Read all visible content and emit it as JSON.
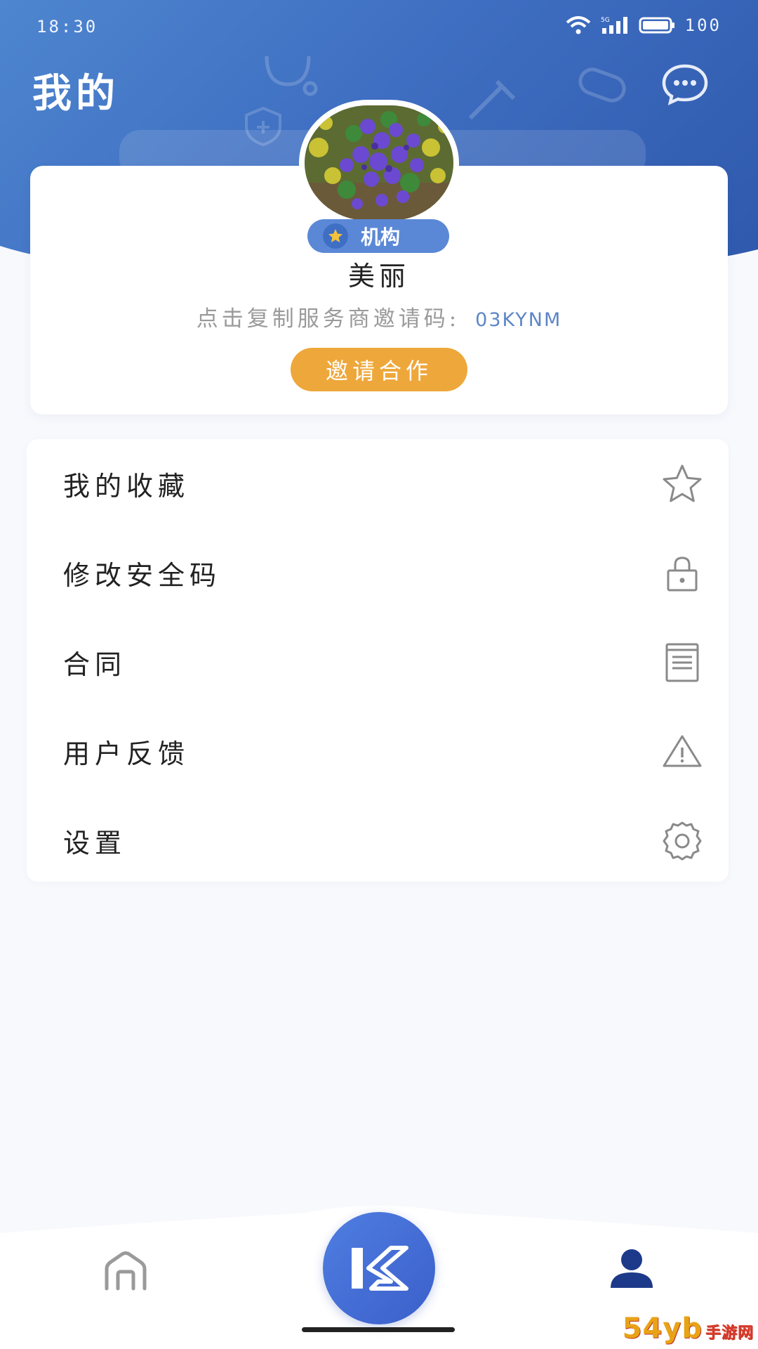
{
  "status_bar": {
    "time": "18:30",
    "battery": "100",
    "network_label": "5G"
  },
  "header": {
    "title": "我的",
    "message_icon": "chat-bubble-icon"
  },
  "profile": {
    "role_badge": "机构",
    "name": "美丽",
    "invite_prompt": "点击复制服务商邀请码:",
    "invite_code": "03KYNM",
    "invite_button": "邀请合作"
  },
  "menu": {
    "items": [
      {
        "label": "我的收藏",
        "icon": "star-icon"
      },
      {
        "label": "修改安全码",
        "icon": "lock-icon"
      },
      {
        "label": "合同",
        "icon": "document-icon"
      },
      {
        "label": "用户反馈",
        "icon": "warning-icon"
      },
      {
        "label": "设置",
        "icon": "gear-icon"
      }
    ]
  },
  "bottom_nav": {
    "items": [
      "home-icon",
      "logo-k-icon",
      "profile-icon"
    ],
    "active": "profile-icon"
  },
  "watermark": {
    "brand": "54yb",
    "sub": "手游网"
  },
  "colors": {
    "header_blue": "#3f6fc2",
    "accent_orange": "#eea73a",
    "badge_blue": "#5b88d6",
    "code_blue": "#5d86c6",
    "nav_active": "#1d3a8a"
  }
}
